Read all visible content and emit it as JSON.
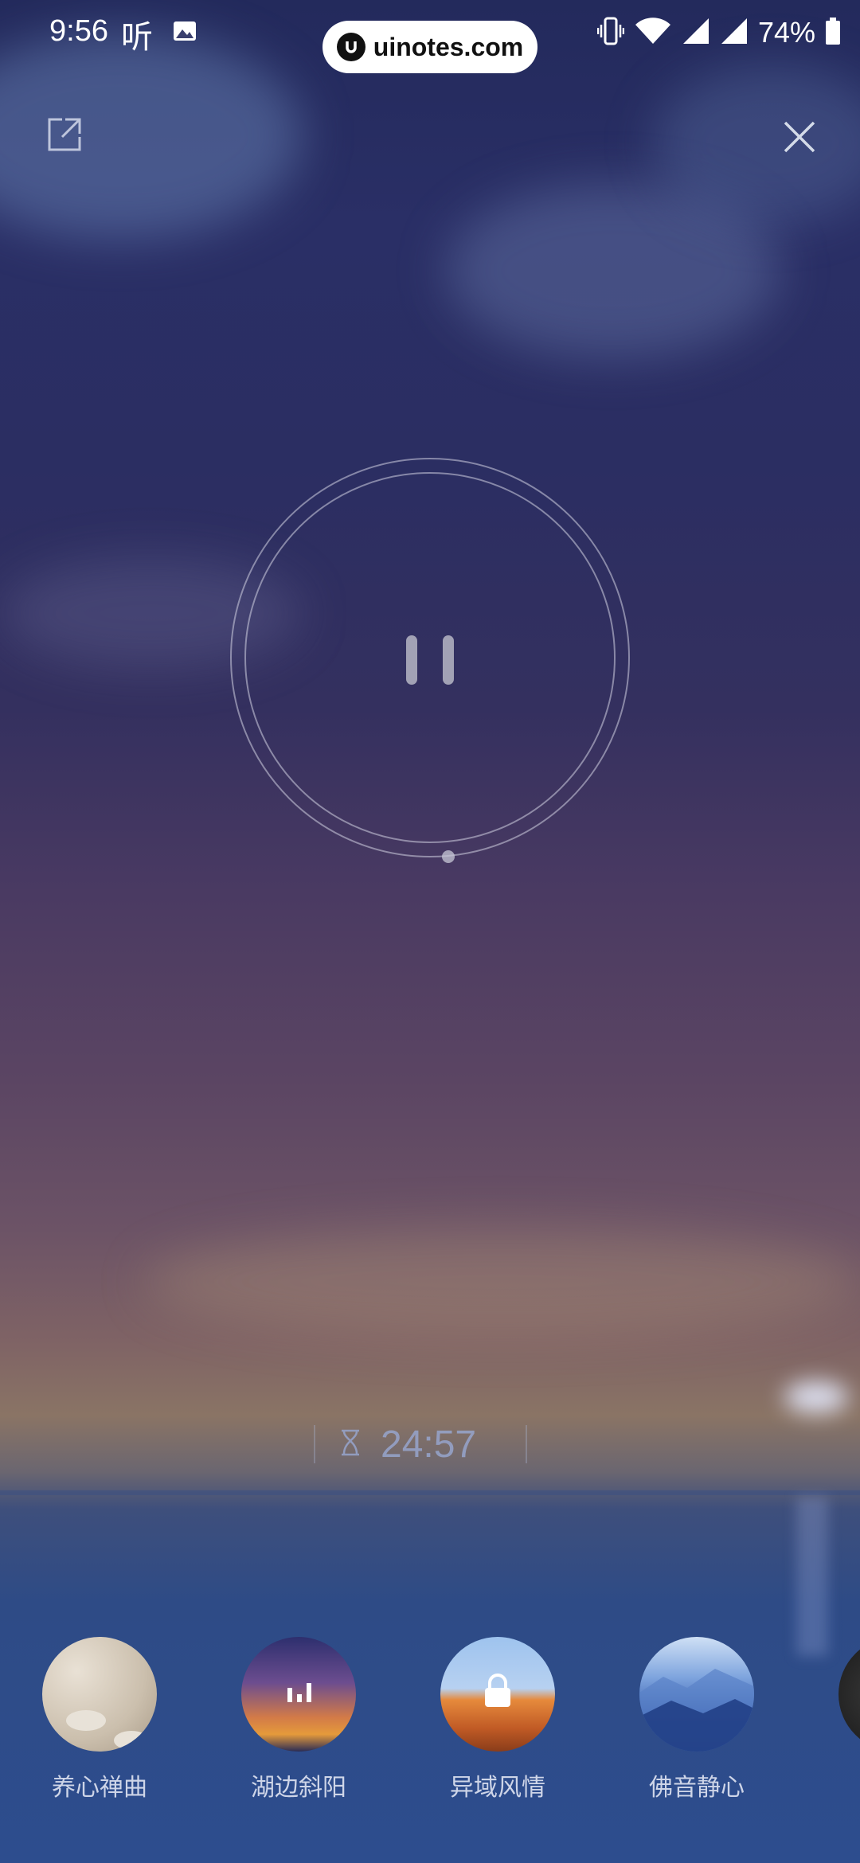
{
  "status_bar": {
    "time": "9:56",
    "app_glyph": "听",
    "watermark": "uinotes.com",
    "battery": "74%",
    "icons": [
      "image-icon",
      "vibrate-icon",
      "wifi-icon",
      "signal-icon",
      "signal-icon",
      "battery-icon"
    ]
  },
  "controls": {
    "share_icon": "share-icon",
    "close_icon": "close-icon"
  },
  "player": {
    "state": "playing",
    "button_icon": "pause-icon"
  },
  "timer": {
    "icon": "hourglass-icon",
    "remaining": "24:57"
  },
  "scenes": [
    {
      "label": "养心禅曲",
      "locked": false,
      "playing": false
    },
    {
      "label": "湖边斜阳",
      "locked": false,
      "playing": true
    },
    {
      "label": "异域风情",
      "locked": true,
      "playing": false
    },
    {
      "label": "佛音静心",
      "locked": false,
      "playing": false
    }
  ],
  "colors": {
    "sky_top": "#232a5c",
    "sky_mid": "#5b4563",
    "sea": "#2d4d8e",
    "label": "#dce1f0"
  }
}
